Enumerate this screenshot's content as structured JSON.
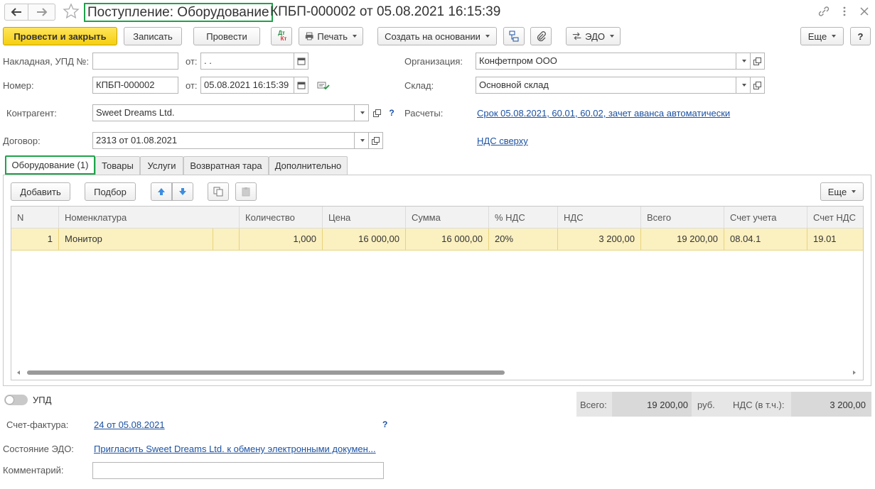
{
  "title": {
    "doc_type": "Поступление: Оборудование",
    "doc_number": "КПБП-000002 от 05.08.2021 16:15:39"
  },
  "toolbar": {
    "post_close": "Провести и закрыть",
    "save": "Записать",
    "post": "Провести",
    "dt_kt_top": "Дт",
    "dt_kt_bottom": "Кт",
    "print": "Печать",
    "create_based": "Создать на основании",
    "edo": "ЭДО",
    "more": "Еще",
    "help": "?"
  },
  "form": {
    "invoice_label": "Накладная, УПД №:",
    "invoice_value": "",
    "from_label": "от:",
    "invoice_date": " .  .",
    "number_label": "Номер:",
    "number_value": "КПБП-000002",
    "number_date": "05.08.2021 16:15:39",
    "contractor_label": "Контрагент:",
    "contractor_value": "Sweet Dreams Ltd.",
    "contract_label": "Договор:",
    "contract_value": "2313 от 01.08.2021",
    "org_label": "Организация:",
    "org_value": "Конфетпром ООО",
    "warehouse_label": "Склад:",
    "warehouse_value": "Основной склад",
    "settlements_label": "Расчеты:",
    "settlements_link": "Срок 05.08.2021, 60.01, 60.02, зачет аванса автоматически",
    "vat_link": "НДС сверху"
  },
  "tabs": [
    "Оборудование (1)",
    "Товары",
    "Услуги",
    "Возвратная тара",
    "Дополнительно"
  ],
  "table_toolbar": {
    "add": "Добавить",
    "pick": "Подбор",
    "more": "Еще"
  },
  "table": {
    "headers": [
      "N",
      "Номенклатура",
      "Количество",
      "Цена",
      "Сумма",
      "% НДС",
      "НДС",
      "Всего",
      "Счет учета",
      "Счет НДС"
    ],
    "rows": [
      [
        "1",
        "Монитор",
        "1,000",
        "16 000,00",
        "16 000,00",
        "20%",
        "3 200,00",
        "19 200,00",
        "08.04.1",
        "19.01"
      ]
    ]
  },
  "footer": {
    "upd_label": "УПД",
    "total_label": "Всего:",
    "total_value": "19 200,00",
    "currency": "руб.",
    "vat_label": "НДС (в т.ч.):",
    "vat_value": "3 200,00",
    "invoice_label": "Счет-фактура:",
    "invoice_link": "24 от 05.08.2021",
    "invoice_help": "?",
    "edo_label": "Состояние ЭДО:",
    "edo_link": "Пригласить Sweet Dreams Ltd. к обмену электронными докумен...",
    "comment_label": "Комментарий:",
    "comment_value": ""
  },
  "colors": {
    "accent_yellow": "#f5cf10",
    "highlight_green": "#1fa34a",
    "row_selected": "#fbf0c0",
    "link": "#1c52a3"
  }
}
